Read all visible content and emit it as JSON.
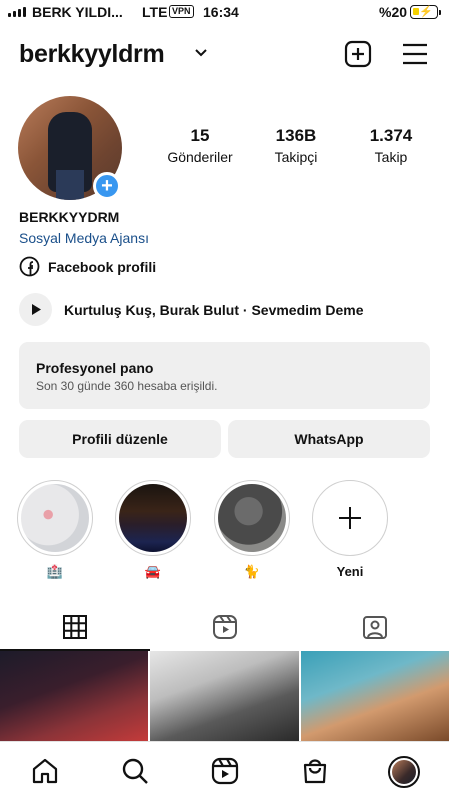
{
  "status_bar": {
    "carrier": "BERK YILDI...",
    "network": "LTE",
    "vpn": "VPN",
    "time": "16:34",
    "battery": "%20"
  },
  "header": {
    "username": "berkkyyldrm",
    "icons": [
      "chevron-down-icon",
      "add-post-icon",
      "menu-icon"
    ]
  },
  "profile": {
    "stats": [
      {
        "value": "15",
        "label": "Gönderiler"
      },
      {
        "value": "136B",
        "label": "Takipçi"
      },
      {
        "value": "1.374",
        "label": "Takip"
      }
    ],
    "display_name": "BERKKYYDRM",
    "category": "Sosyal Medya Ajansı",
    "facebook_link": "Facebook profili",
    "music": "Kurtuluş Kuş, Burak Bulut · Sevmedim Deme"
  },
  "professional_dashboard": {
    "title": "Profesyonel pano",
    "subtitle": "Son 30 günde 360 hesaba erişildi."
  },
  "buttons": {
    "edit_profile": "Profili düzenle",
    "whatsapp": "WhatsApp"
  },
  "highlights": [
    {
      "label": "🏥"
    },
    {
      "label": "🚘"
    },
    {
      "label": "🐈"
    },
    {
      "label": "Yeni"
    }
  ],
  "tabs": [
    "grid-icon",
    "reels-icon",
    "tagged-icon"
  ],
  "bottom_nav": [
    "home-icon",
    "search-icon",
    "reels-icon",
    "shop-icon",
    "profile-avatar"
  ]
}
